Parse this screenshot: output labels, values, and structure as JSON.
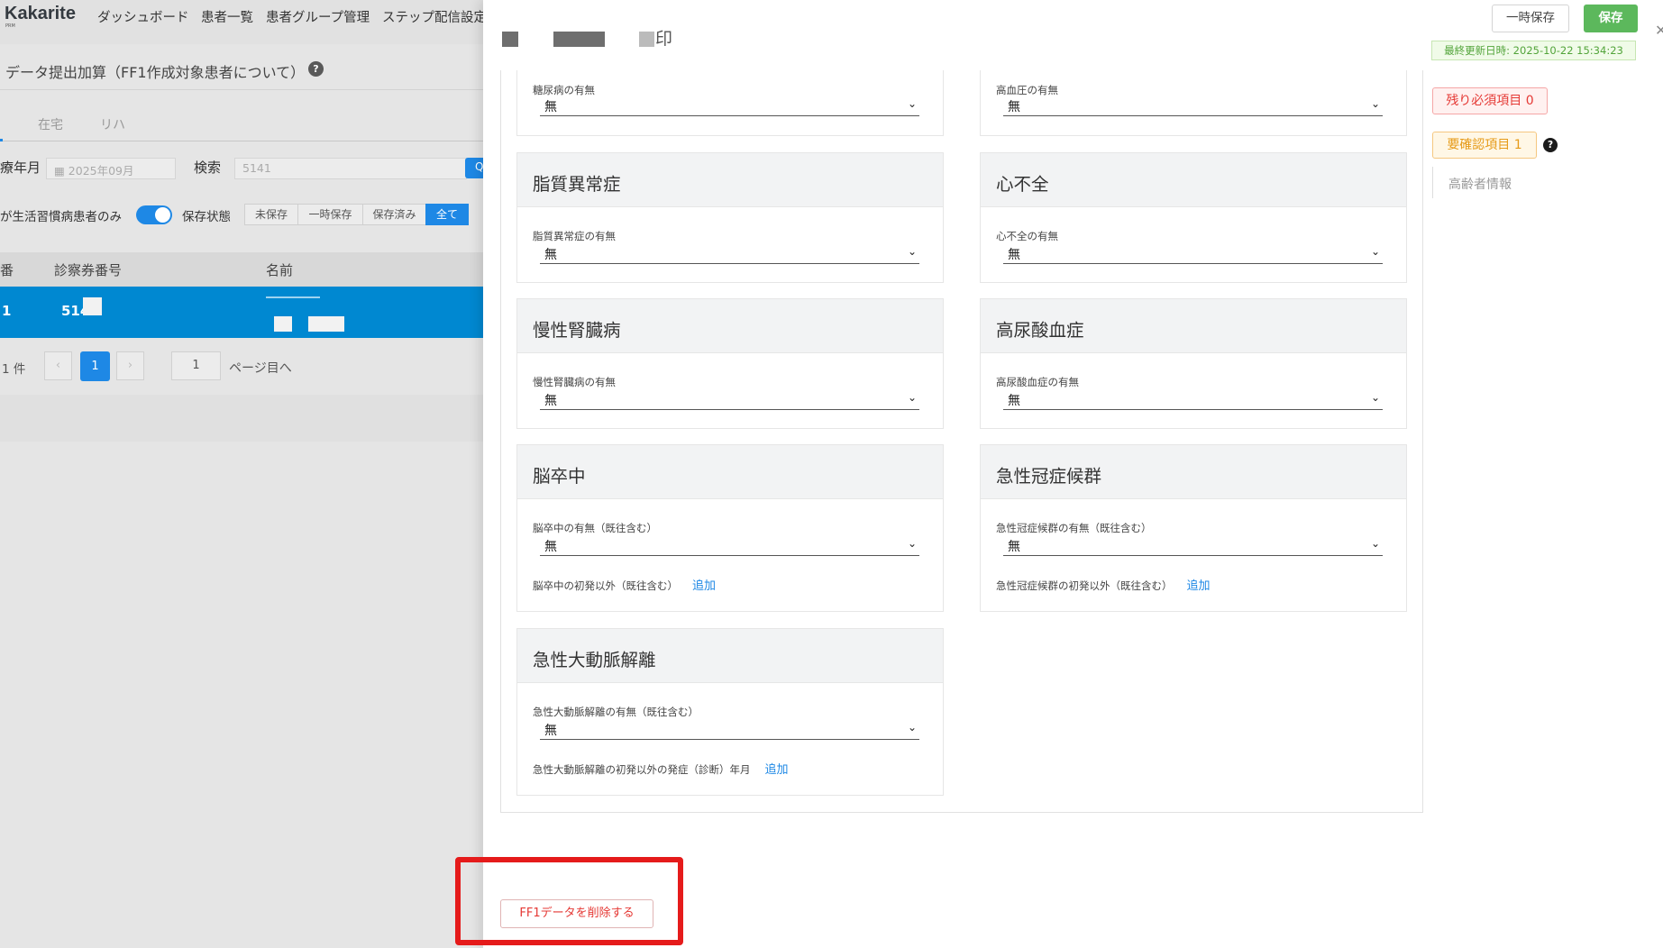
{
  "app": {
    "logo": "Kakarite",
    "logo_sub": "PRM",
    "nav": [
      "ダッシュボード",
      "患者一覧",
      "患者グループ管理",
      "ステップ配信設定"
    ]
  },
  "list_page": {
    "title": "データ提出加算（FF1作成対象患者について）",
    "help_icon": "?",
    "tabs": [
      "在宅",
      "リハ"
    ],
    "filters": {
      "month_label": "療年月",
      "month_placeholder": "2025年09月",
      "search_label": "検索",
      "search_value": "5141",
      "search_button": "Q",
      "lifestyle_label": "が生活習慣病患者のみ",
      "lifestyle_toggle": "on",
      "save_state_label": "保存状態",
      "save_states": [
        "未保存",
        "一時保存",
        "保存済み",
        "全て"
      ],
      "save_state_selected": "全て"
    },
    "table": {
      "headers": [
        "番",
        "診察券番号",
        "名前"
      ],
      "rows": [
        {
          "no": "1",
          "card_no": "514"
        }
      ]
    },
    "pager": {
      "count": "1 件",
      "prev": "‹",
      "current": "1",
      "next": "›",
      "jump_value": "1",
      "jump_label": "ページ目へ"
    }
  },
  "drawer": {
    "header_char": "印",
    "actions": {
      "temp_save": "一時保存",
      "save": "保存",
      "last_updated": "最終更新日時: 2025-10-22 15:34:23"
    },
    "status": {
      "remaining_required": "残り必須項目 0",
      "needs_confirmation": "要確認項目 1",
      "help_icon": "?",
      "anchor_link": "高齢者情報"
    },
    "top_partial": {
      "left_label": "糖尿病の有無",
      "left_value": "無",
      "right_label": "高血圧の有無",
      "right_value": "無"
    },
    "cards": [
      {
        "title": "脂質異常症",
        "label": "脂質異常症の有無",
        "value": "無"
      },
      {
        "title": "心不全",
        "label": "心不全の有無",
        "value": "無"
      },
      {
        "title": "慢性腎臓病",
        "label": "慢性腎臓病の有無",
        "value": "無"
      },
      {
        "title": "高尿酸血症",
        "label": "高尿酸血症の有無",
        "value": "無"
      },
      {
        "title": "脳卒中",
        "label": "脳卒中の有無（既往含む）",
        "value": "無",
        "extra_label": "脳卒中の初発以外（既往含む）",
        "extra_link": "追加"
      },
      {
        "title": "急性冠症候群",
        "label": "急性冠症候群の有無（既往含む）",
        "value": "無",
        "extra_label": "急性冠症候群の初発以外（既往含む）",
        "extra_link": "追加"
      },
      {
        "title": "急性大動脈解離",
        "label": "急性大動脈解離の有無（既往含む）",
        "value": "無",
        "extra_label": "急性大動脈解離の初発以外の発症（診断）年月",
        "extra_link": "追加"
      }
    ],
    "delete_button": "FF1データを削除する"
  },
  "colors": {
    "primary": "#1e88e5",
    "save_green": "#5cb85c",
    "danger": "#e53935",
    "warning": "#e69a17",
    "highlight_box": "#e51b1b",
    "row_selected": "#0088d1"
  }
}
